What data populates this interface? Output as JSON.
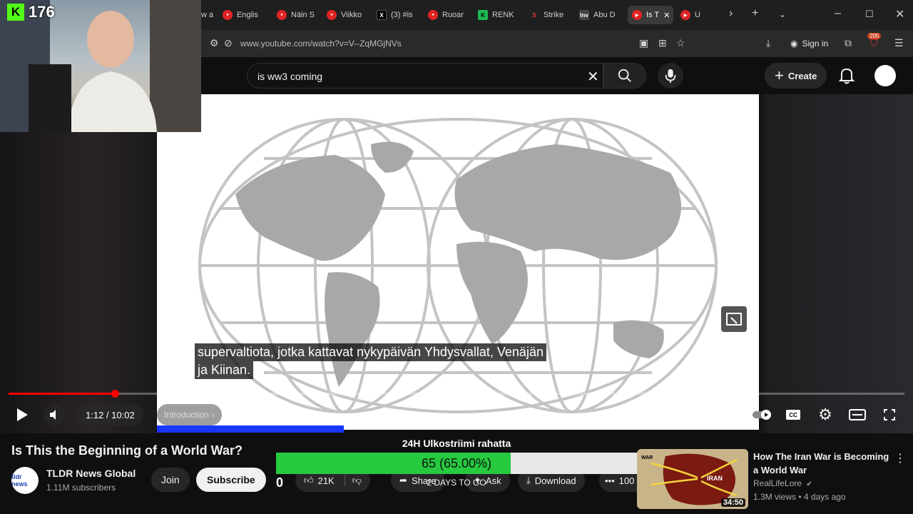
{
  "browser": {
    "tabs": [
      {
        "label": "w a",
        "favicon": "generic"
      },
      {
        "label": "Englis",
        "favicon": "red-circle"
      },
      {
        "label": "Näin S",
        "favicon": "red-circle"
      },
      {
        "label": "Viikko",
        "favicon": "red-circle"
      },
      {
        "label": "(3) #is",
        "favicon": "x-logo"
      },
      {
        "label": "Ruoar",
        "favicon": "red-circle"
      },
      {
        "label": "RENK",
        "favicon": "kick-logo"
      },
      {
        "label": "Strike",
        "favicon": "strike-logo"
      },
      {
        "label": "Abu D",
        "favicon": "inv-logo"
      },
      {
        "label": "Is T",
        "favicon": "youtube-logo",
        "active": true
      },
      {
        "label": "U",
        "favicon": "youtube-logo"
      }
    ],
    "url": "www.youtube.com/watch?v=V--ZqMGjNVs",
    "sign_in": "Sign in",
    "extension_badge": "205"
  },
  "youtube": {
    "search_query": "is ww3 coming",
    "create_label": "Create"
  },
  "player": {
    "subtitle_lines": [
      "supervaltiota, jotka kattavat nykypäivän Yhdysvallat, Venäjän",
      "ja Kiinan."
    ],
    "time": "1:12 / 10:02",
    "chapter": "Introduction",
    "progress_fraction": 0.119
  },
  "video": {
    "title": "Is This the Beginning of a World War?",
    "channel_name": "TLDR News Global",
    "channel_avatar_text": "tldr news",
    "subscribers": "1.11M subscribers",
    "join_label": "Join",
    "subscribe_label": "Subscribe",
    "likes": "21K",
    "share_label": "Share",
    "ask_label": "Ask",
    "download_label": "Download",
    "more_label": "100"
  },
  "stream_goal": {
    "label": "24H Ulkostriimi rahatta",
    "progress_text": "65 (65.00%)",
    "fraction": 0.65,
    "left_value": "0",
    "days_text": "2 DAYS TO GO"
  },
  "recommended": {
    "title": "How The Iran War is Becoming a World War",
    "channel": "RealLifeLore",
    "meta": "1.3M views • 4 days ago",
    "duration": "34:50",
    "thumb_label": "IRAN",
    "thumb_war": "WAR"
  },
  "stream_overlay": {
    "viewer_count": "176",
    "logo_text": "K"
  },
  "colors": {
    "accent": "#ff0000",
    "goal_fill": "#27c93f",
    "chapter_bar": "#1838ff"
  }
}
